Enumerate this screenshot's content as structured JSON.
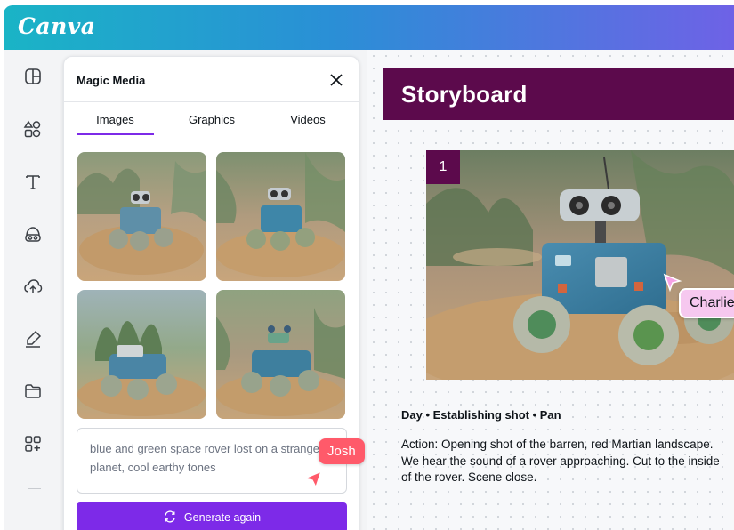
{
  "app": {
    "logo_text": "Canva"
  },
  "leftrail": {
    "items": [
      {
        "name": "design",
        "icon": "layout-icon"
      },
      {
        "name": "elements",
        "icon": "shapes-icon"
      },
      {
        "name": "text",
        "icon": "text-icon"
      },
      {
        "name": "brand",
        "icon": "brand-icon"
      },
      {
        "name": "uploads",
        "icon": "cloud-upload-icon"
      },
      {
        "name": "draw",
        "icon": "pen-icon"
      },
      {
        "name": "projects",
        "icon": "folder-icon"
      },
      {
        "name": "apps",
        "icon": "apps-icon"
      }
    ]
  },
  "panel": {
    "title": "Magic Media",
    "tabs": [
      {
        "label": "Images",
        "active": true
      },
      {
        "label": "Graphics",
        "active": false
      },
      {
        "label": "Videos",
        "active": false
      }
    ],
    "prompt_text": "blue and green space rover lost on a strange\nplanet, cool earthy tones",
    "generate_label": "Generate again",
    "collaborator": "Josh"
  },
  "canvas": {
    "banner_title": "Storyboard",
    "scene_number": "1",
    "collaborator": "Charlie",
    "shot_title": "Day • Establishing shot • Pan",
    "shot_description": "Action: Opening shot of the barren, red Martian landscape.\nWe hear the sound of a rover approaching. Cut to the inside\nof the rover. Scene close."
  },
  "colors": {
    "accent_purple": "#7d2ae8",
    "banner": "#5c0a4c",
    "josh_tag": "#ff5a6a",
    "charlie_tag": "#f6c8ef"
  }
}
